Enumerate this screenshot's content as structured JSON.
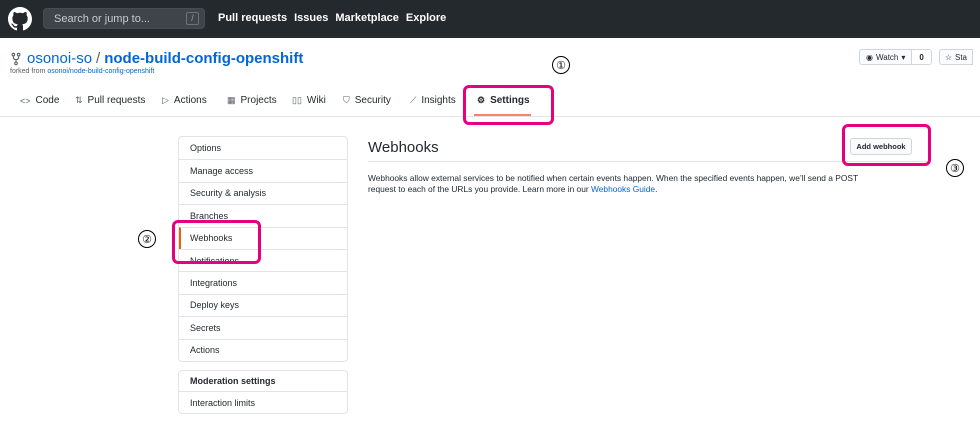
{
  "header": {
    "search_placeholder": "Search or jump to...",
    "slash_key": "/",
    "nav": [
      "Pull requests",
      "Issues",
      "Marketplace",
      "Explore"
    ]
  },
  "repo": {
    "owner": "osonoi-so",
    "separator": "/",
    "name": "node-build-config-openshift",
    "forked_prefix": "forked from",
    "forked_link": "osonoi/node-build-config-openshift",
    "watch_label": "Watch",
    "watch_count": "0",
    "star_label": "Sta"
  },
  "tabs": {
    "code": "Code",
    "pulls": "Pull requests",
    "actions": "Actions",
    "projects": "Projects",
    "wiki": "Wiki",
    "security": "Security",
    "insights": "Insights",
    "settings": "Settings"
  },
  "menu": {
    "items": [
      "Options",
      "Manage access",
      "Security & analysis",
      "Branches",
      "Webhooks",
      "Notifications",
      "Integrations",
      "Deploy keys",
      "Secrets",
      "Actions"
    ],
    "moderation_head": "Moderation settings",
    "moderation_items": [
      "Interaction limits"
    ]
  },
  "content": {
    "title": "Webhooks",
    "add_button": "Add webhook",
    "desc_line1": "Webhooks allow external services to be notified when certain events happen. When the specified events happen, we’ll send a POST",
    "desc_line2": "request to each of the URLs you provide. Learn more in our ",
    "desc_link": "Webhooks Guide",
    "desc_end": "."
  },
  "annotations": {
    "one": "①",
    "two": "②",
    "three": "③",
    "highlight_color": "#e6007e"
  },
  "icons": {
    "logo": "github-logo-icon",
    "fork": "fork-icon",
    "eye": "eye-icon",
    "star": "star-icon",
    "gear": "gear-icon"
  }
}
